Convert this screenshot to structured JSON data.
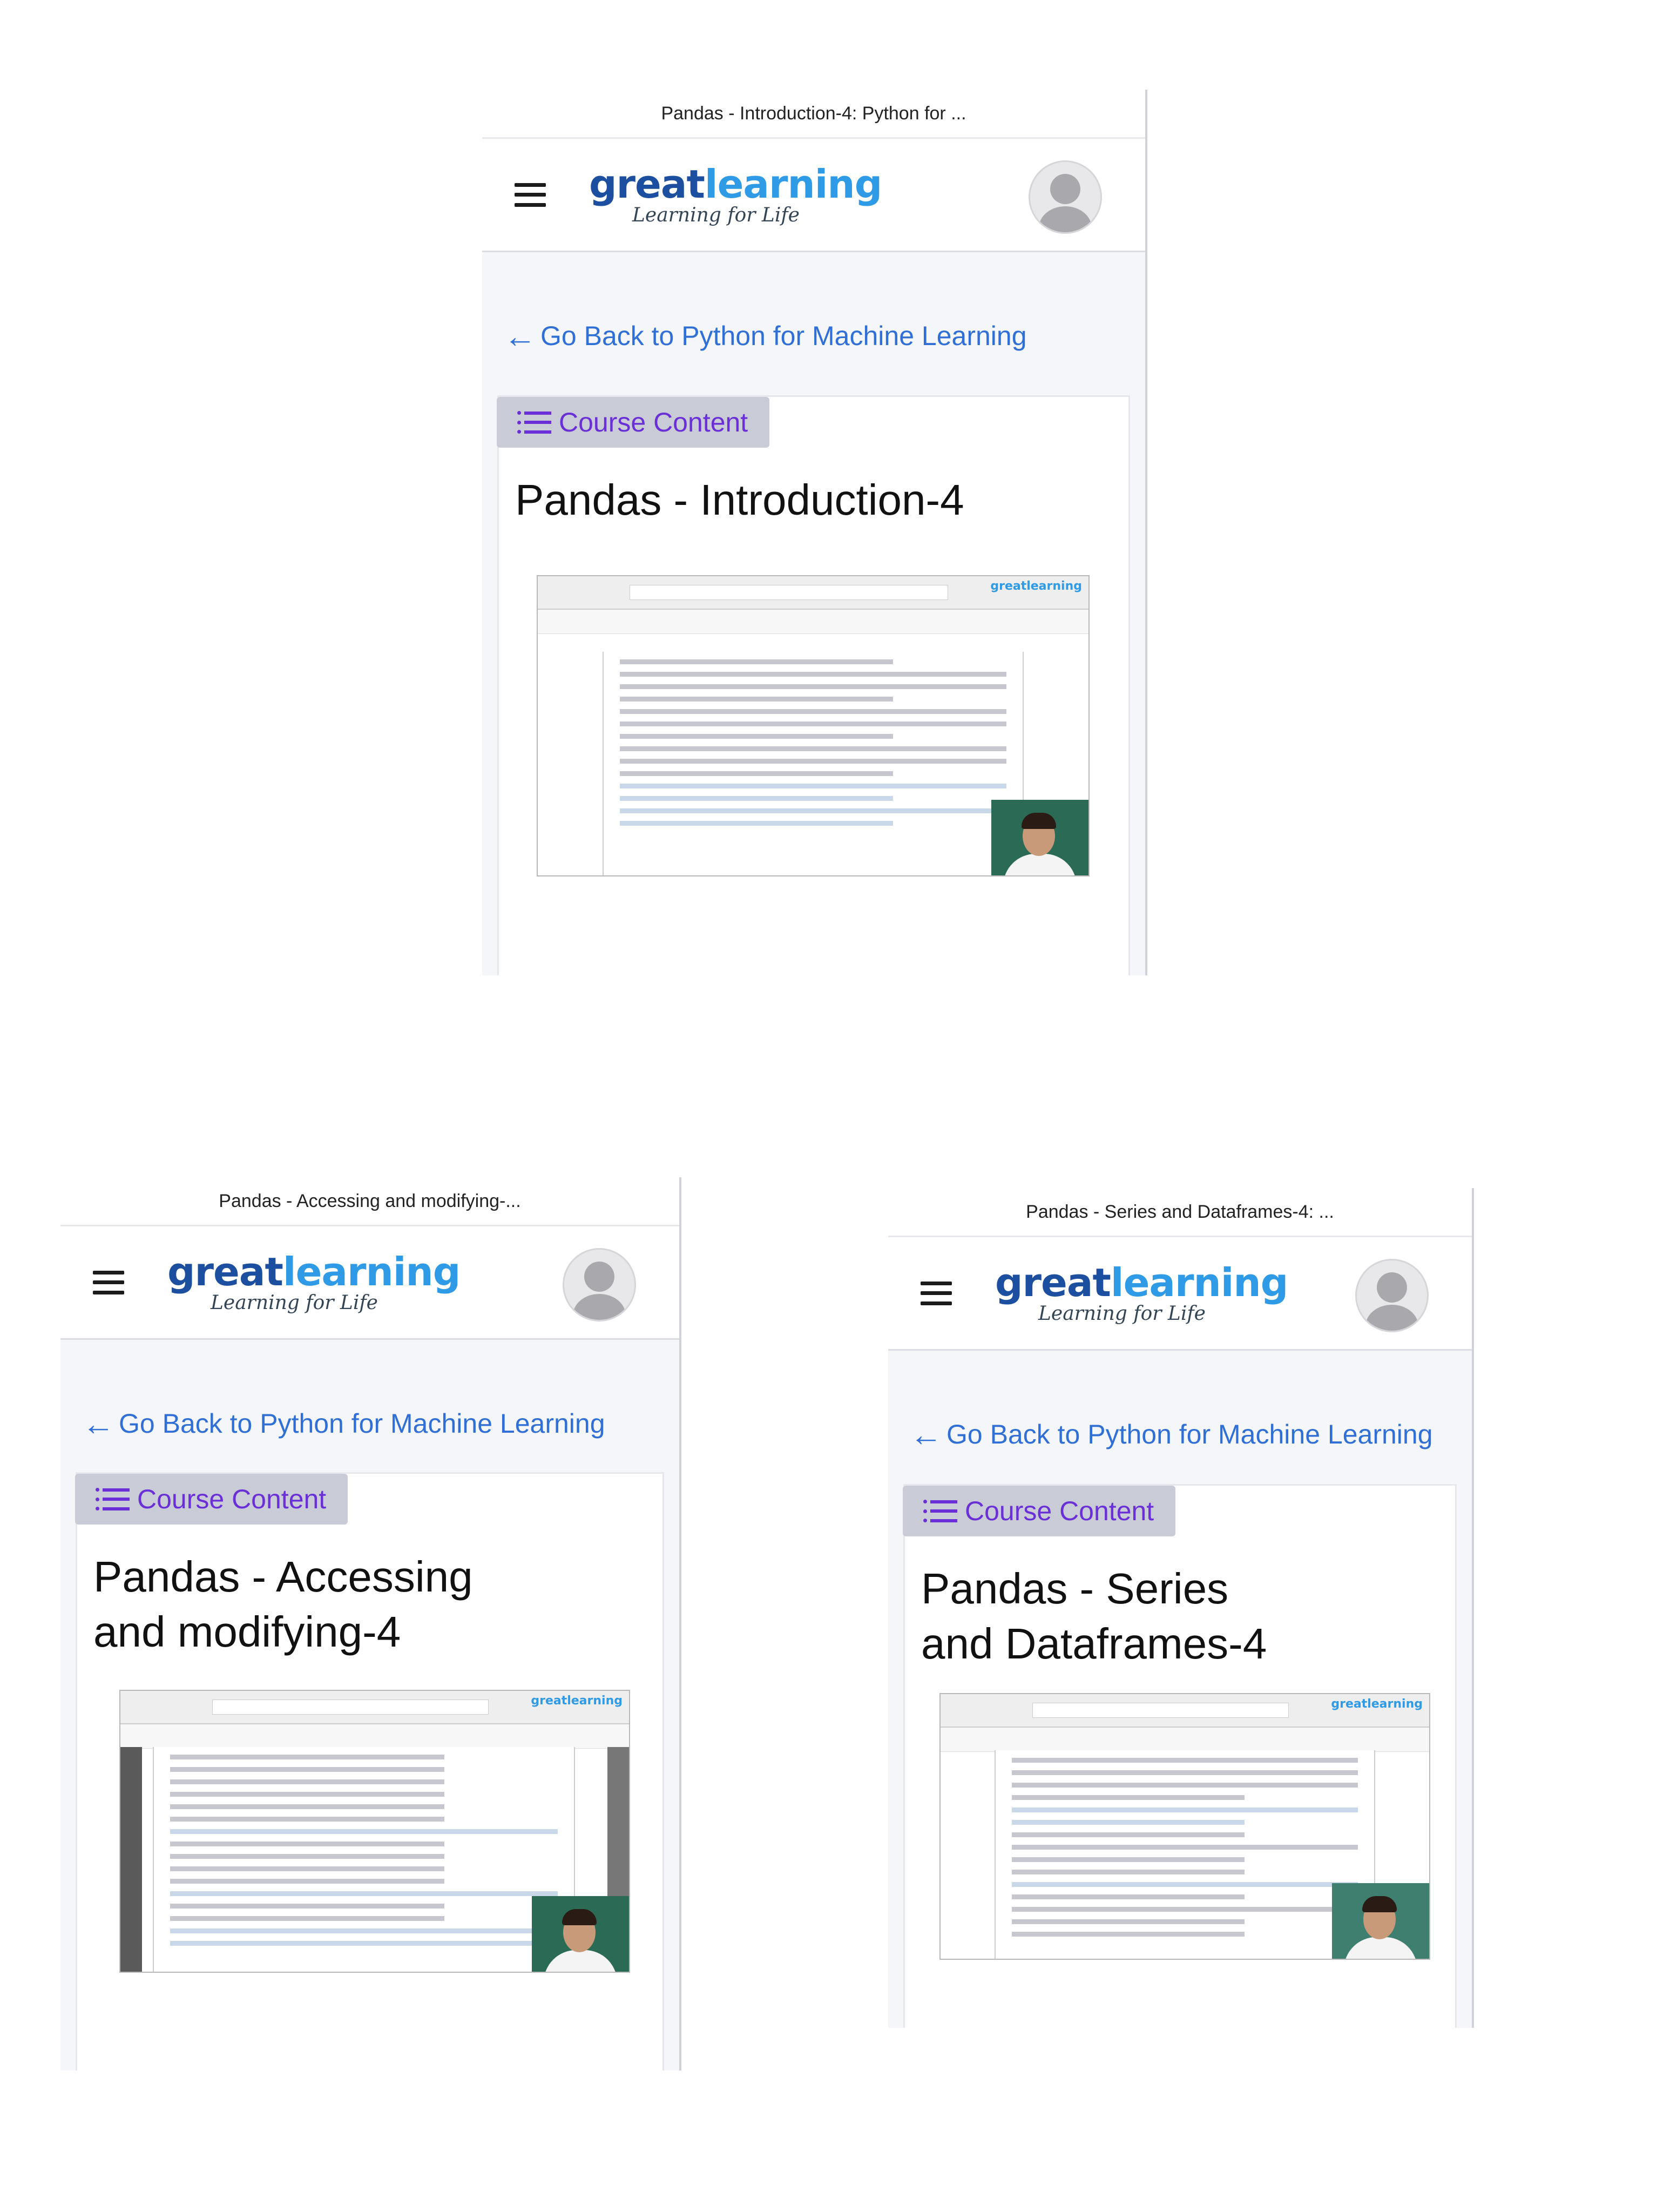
{
  "screens": [
    {
      "window_title": "Pandas - Introduction-4: Python for ...",
      "brand_a": "great",
      "brand_b": "learning",
      "tagline": "Learning for Life",
      "back_link": "Go Back to Python for Machine Learning",
      "course_content_label": "Course Content",
      "lesson_title": "Pandas - Introduction-4",
      "video_logo": "greatlearning"
    },
    {
      "window_title": "Pandas - Accessing and modifying-...",
      "brand_a": "great",
      "brand_b": "learning",
      "tagline": "Learning for Life",
      "back_link": "Go Back to Python for Machine Learning",
      "course_content_label": "Course Content",
      "lesson_title": "Pandas - Accessing and modifying-4",
      "video_logo": "greatlearning"
    },
    {
      "window_title": "Pandas - Series and Dataframes-4: ...",
      "brand_a": "great",
      "brand_b": "learning",
      "tagline": "Learning for Life",
      "back_link": "Go Back to Python for Machine Learning",
      "course_content_label": "Course Content",
      "lesson_title": "Pandas - Series and Dataframes-4",
      "video_logo": "greatlearning"
    }
  ],
  "icons": {
    "menu": "hamburger-menu-icon",
    "avatar": "user-avatar-icon",
    "back": "arrow-left-icon",
    "course_content": "list-icon"
  },
  "colors": {
    "brand_dark": "#1d4fa0",
    "brand_light": "#2f9be6",
    "link": "#2f6fd6",
    "course_content_text": "#6a2fd6",
    "course_content_bg": "#c9ccd6"
  }
}
